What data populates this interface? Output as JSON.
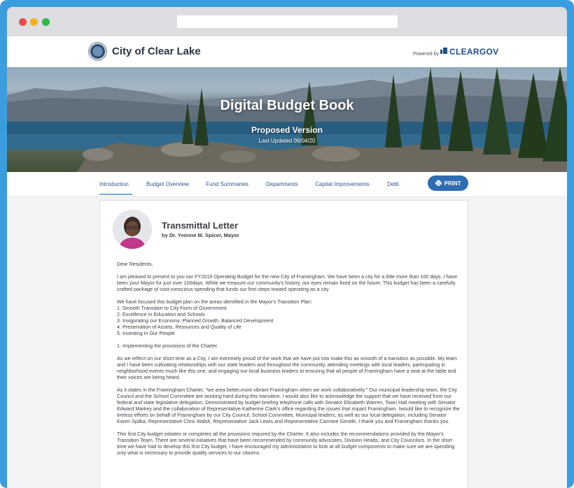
{
  "site": {
    "title": "City of Clear Lake",
    "powered_by": "Powered by",
    "brand": "CLEARGOV"
  },
  "hero": {
    "title": "Digital Budget Book",
    "subtitle": "Proposed Version",
    "updated": "Last Updated 06/04/20"
  },
  "nav": {
    "items": [
      {
        "label": "Introduction"
      },
      {
        "label": "Budget Overview"
      },
      {
        "label": "Fund Summaries"
      },
      {
        "label": "Departments"
      },
      {
        "label": "Capital Improvements"
      },
      {
        "label": "Debt"
      }
    ],
    "print_label": "PRINT"
  },
  "letter": {
    "title": "Transmittal Letter",
    "author": "by Dr. Yvonne M. Spicer, Mayor",
    "greeting": "Dear Residents,",
    "p1": "I am pleased to present to you our FY2019 Operating Budget for the new City of Framingham.  We have been a city for a little more than 100 days. I have been your Mayor for just over 100days.  While we treasure our community's history, our eyes remain fixed on the future.  This budget has been a carefully crafted package of cost-conscious spending that funds our first steps toward operating as a city.",
    "p2_intro": "We have focused this budget plan on the areas identified in the Mayor's Transition Plan:",
    "p2_items": [
      "1. Smooth Transition to City Form of Government",
      "2. Excellence in Education and Schools",
      "3. Invigorating our Economy: Planned Growth, Balanced Development",
      "4. Preservation of Assets, Resources and Quality of Life",
      "5. Investing in Our People"
    ],
    "p3": "1. Implementing the provisions of the Charter",
    "p4": "As we reflect on our short time as a City, I am extremely proud of the work that we have put into make this as smooth of a transition as possible. My team and I have been cultivating relationships with our state leaders and throughout the community, attending meetings with local leaders, participating in neighborhood events much like this one, and engaging our local business leaders to ensuring that all people of Framingham have a seat at the table and their voices are being heard.",
    "p5": "As it states in the Framingham Charter, \"we area better,more vibrant Framingham when we work collaboratively.\"  Our municipal leadership team, the City Council and the School Committee are working hard during this transition. I would also like to acknowledge the support that we have received from our federal and state legislative delegation. Demonstrated by budget briefing telephone calls with Senator Elizabeth Warren, Town Hall meeting with Senator Edward Markey and the collaboration of Representative Katherine Clark's office regarding the issues that impact Framingham. Iwould like to recognize the tireless efforts on behalf of Framingham by our City Council, School Committee, Municipal leaders, as well as our local delegation, including Senator Karen Spilka, Representative Chris Walsh, Representative Jack Lewis and Representative Carmine Gentile, I thank you and Framingham thanks you.",
    "p6": "This first City budget initiates or completes all the provisions required by the Charter. It also includes the recommendations provided by the Mayor's Transition Team. There are several initiatives that have been recommended by community advocates, Division Heads, and City Councilors.  In the short time we have had to develop this first City budget, I have encouraged my administration to look at all budget components to make sure we are spending only what is necessary to provide quality services to our citizens."
  },
  "colors": {
    "frame": "#3a9ede",
    "nav_link": "#2e5a8f",
    "print_button": "#2f6db3",
    "brand": "#1f4e86"
  }
}
